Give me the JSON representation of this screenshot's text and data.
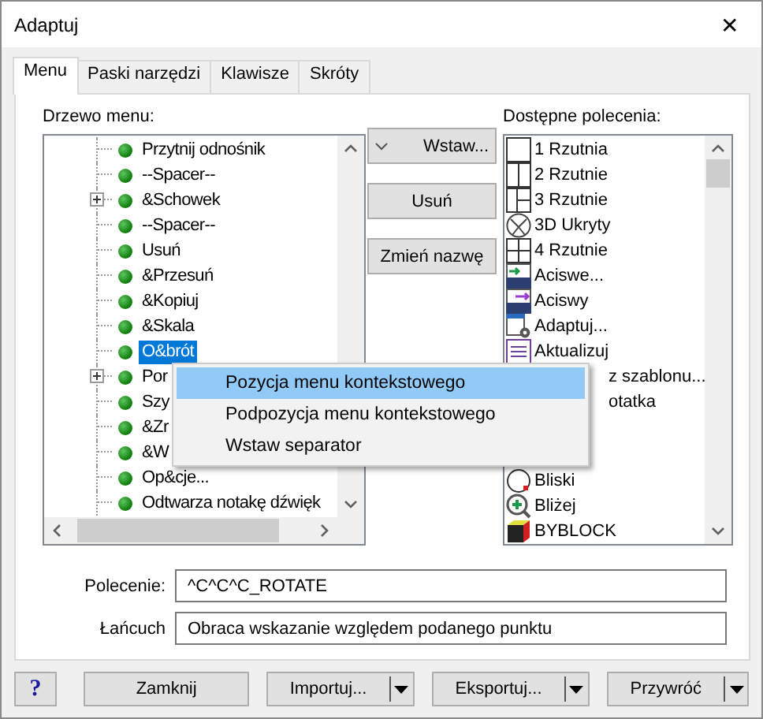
{
  "window": {
    "title": "Adaptuj",
    "close": "✕"
  },
  "tabs": [
    {
      "label": "Menu",
      "selected": true
    },
    {
      "label": "Paski narzędzi",
      "selected": false
    },
    {
      "label": "Klawisze",
      "selected": false
    },
    {
      "label": "Skróty",
      "selected": false
    }
  ],
  "tree": {
    "label": "Drzewo menu:",
    "items": [
      {
        "label": "Przytnij odnośnik",
        "kind": "leaf",
        "selected": false
      },
      {
        "label": "--Spacer--",
        "kind": "leaf",
        "selected": false
      },
      {
        "label": "&Schowek",
        "kind": "group",
        "expanded": false,
        "selected": false
      },
      {
        "label": "--Spacer--",
        "kind": "leaf",
        "selected": false
      },
      {
        "label": "Usuń",
        "kind": "leaf",
        "selected": false
      },
      {
        "label": "&Przesuń",
        "kind": "leaf",
        "selected": false
      },
      {
        "label": "&Kopiuj",
        "kind": "leaf",
        "selected": false
      },
      {
        "label": "&Skala",
        "kind": "leaf",
        "selected": false
      },
      {
        "label": "O&brót",
        "kind": "leaf",
        "selected": true
      },
      {
        "label": "Por",
        "kind": "group",
        "expanded": false,
        "selected": false
      },
      {
        "label": "Szy",
        "kind": "leaf",
        "selected": false
      },
      {
        "label": "&Zr",
        "kind": "leaf",
        "selected": false
      },
      {
        "label": "&W",
        "kind": "leaf",
        "selected": false
      },
      {
        "label": "Op&cje...",
        "kind": "leaf",
        "selected": false
      },
      {
        "label": "Odtwarza notakę dźwięk",
        "kind": "leaf",
        "selected": false
      }
    ]
  },
  "actions": [
    {
      "label": "Wstaw...",
      "kind": "dropdown"
    },
    {
      "label": "Usuń",
      "kind": "plain"
    },
    {
      "label": "Zmień nazwę",
      "kind": "plain"
    }
  ],
  "commands": {
    "label": "Dostępne polecenia:",
    "items": [
      {
        "label": "1 Rzutnia",
        "kind": "viewport1"
      },
      {
        "label": "2 Rzutnie",
        "kind": "viewport2"
      },
      {
        "label": "3 Rzutnie",
        "kind": "viewport3"
      },
      {
        "label": "3D Ukryty",
        "kind": "hidden3d"
      },
      {
        "label": "4 Rzutnie",
        "kind": "viewport4"
      },
      {
        "label": "Aciswe...",
        "kind": "acis-in"
      },
      {
        "label": "Aciswy",
        "kind": "acis-out"
      },
      {
        "label": "Adaptuj...",
        "kind": "adapt"
      },
      {
        "label": "Aktualizuj",
        "kind": "update"
      },
      {
        "label": "z szablonu...",
        "kind": "covered"
      },
      {
        "label": "otatka",
        "kind": "covered"
      }
    ],
    "items_bottom": [
      {
        "label": "Bliski",
        "kind": "near"
      },
      {
        "label": "Bliżej",
        "kind": "zoom-in"
      },
      {
        "label": "BYBLOCK",
        "kind": "byblock"
      }
    ]
  },
  "fields": [
    {
      "label": "Polecenie:",
      "value": "^C^C^C_ROTATE"
    },
    {
      "label": "Łańcuch",
      "value": "Obraca wskazanie względem podanego punktu"
    }
  ],
  "context_menu": [
    {
      "label": "Pozycja menu kontekstowego",
      "selected": true
    },
    {
      "label": "Podpozycja menu kontekstowego",
      "selected": false
    },
    {
      "label": "Wstaw separator",
      "selected": false
    }
  ],
  "footer": {
    "help": "?",
    "buttons": [
      {
        "label": "Zamknij",
        "kind": "plain"
      },
      {
        "label": "Importuj...",
        "kind": "split"
      },
      {
        "label": "Eksportuj...",
        "kind": "split"
      },
      {
        "label": "Przywróć",
        "kind": "split"
      }
    ]
  }
}
